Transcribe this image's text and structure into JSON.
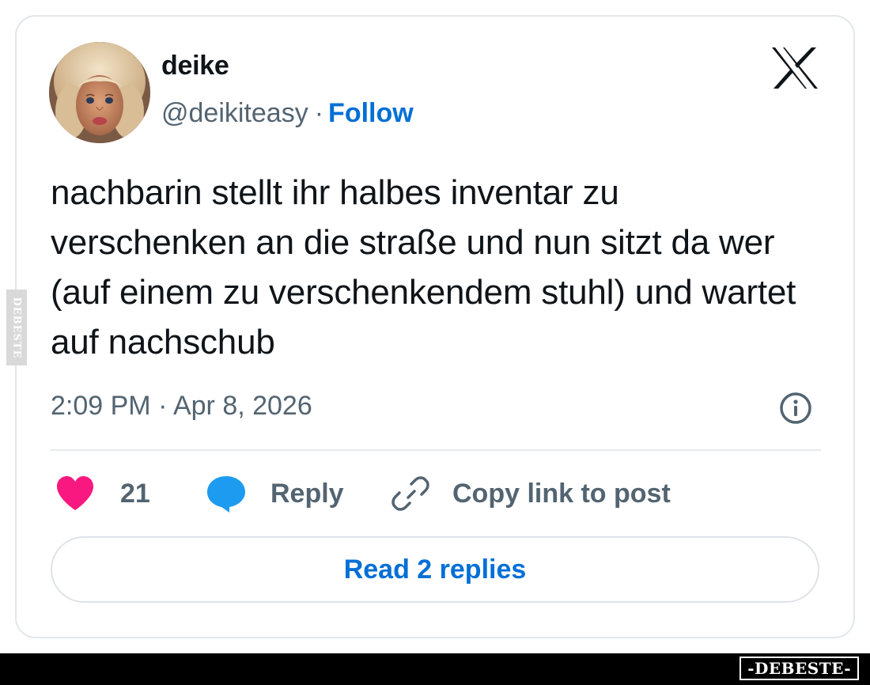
{
  "author": {
    "name": "deike",
    "handle": "@deikiteasy",
    "separator": "·",
    "follow_label": "Follow"
  },
  "tweet": {
    "text": "nachbarin stellt ihr halbes inventar zu verschenken an die straße und nun sitzt da wer (auf einem zu verschenkendem stuhl) und wartet auf nachschub",
    "timestamp": "2:09 PM · Apr 8, 2026"
  },
  "actions": {
    "like_count": "21",
    "reply_label": "Reply",
    "copy_link_label": "Copy link to post"
  },
  "read_replies_label": "Read 2 replies",
  "watermark": {
    "side": "DEBESTE",
    "brand": "-DEBESTE-"
  },
  "icons": {
    "platform_logo": "x-logo-icon",
    "info": "info-icon",
    "like": "heart-icon",
    "reply": "speech-bubble-icon",
    "copy": "link-icon"
  },
  "colors": {
    "text": "#0f1419",
    "secondary": "#536471",
    "link": "#006fd6",
    "like": "#f91880",
    "reply": "#1d9bf0",
    "border": "#e3e6ea"
  }
}
